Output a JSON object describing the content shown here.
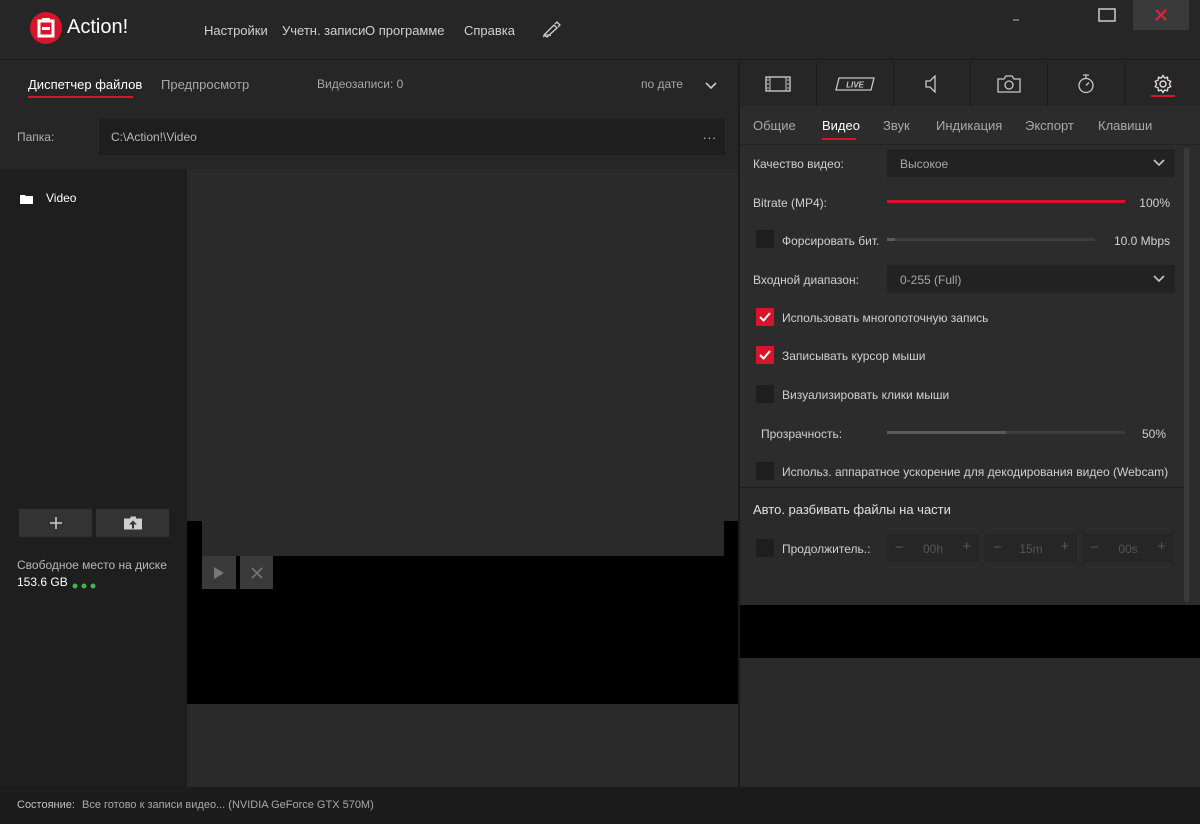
{
  "app": {
    "name": "Action!"
  },
  "menu": [
    "Настройки",
    "Учетн. записи",
    "О программе",
    "Справка"
  ],
  "left_tabs": {
    "file_manager": "Диспетчер файлов",
    "preview": "Предпросмотр",
    "video_count": "Видеозаписи: 0",
    "sort": "по дате"
  },
  "folder": {
    "label": "Папка:",
    "path": "C:\\Action!\\Video",
    "more": "..."
  },
  "tree": {
    "items": [
      "Video"
    ]
  },
  "disk": {
    "label": "Свободное место на диске",
    "value": "153.6 GB"
  },
  "icon_tabs": [
    "film-icon",
    "live-icon",
    "speaker-icon",
    "camera-icon",
    "timer-icon",
    "gear-icon"
  ],
  "icon_tabs_live_text": "LIVE",
  "settings": {
    "subtabs": [
      "Общие",
      "Видео",
      "Звук",
      "Индикация",
      "Экспорт",
      "Клавиши"
    ],
    "quality": {
      "label": "Качество видео:",
      "value": "Высокое"
    },
    "bitrate": {
      "label": "Bitrate (MP4):",
      "value": "100%",
      "level": 1.0
    },
    "force_bitrate": {
      "label": "Форсировать бит.",
      "value": "10.0 Mbps",
      "checked": false,
      "level": 0.04
    },
    "input_range": {
      "label": "Входной диапазон:",
      "value": "0-255 (Full)"
    },
    "multithread": {
      "label": "Использовать многопоточную запись",
      "checked": true
    },
    "cursor": {
      "label": "Записывать курсор мыши",
      "checked": true
    },
    "clicks": {
      "label": "Визуализировать клики мыши",
      "checked": false
    },
    "opacity": {
      "label": "Прозрачность:",
      "value": "50%",
      "level": 0.5
    },
    "hw_accel": {
      "label": "Использ. аппаратное ускорение для декодирования видео (Webcam)",
      "checked": false
    },
    "split": {
      "title": "Авто. разбивать файлы на части",
      "duration_label": "Продолжитель.:",
      "hours": "00h",
      "minutes": "15m",
      "seconds": "00s",
      "minus": "−",
      "plus": "+"
    }
  },
  "status": {
    "label": "Состояние:",
    "text": "Все готово к записи видео...  (NVIDIA GeForce GTX 570M)"
  },
  "colors": {
    "accent": "#d6152a",
    "background": "#262626",
    "green_dot": "#3bb54a"
  }
}
